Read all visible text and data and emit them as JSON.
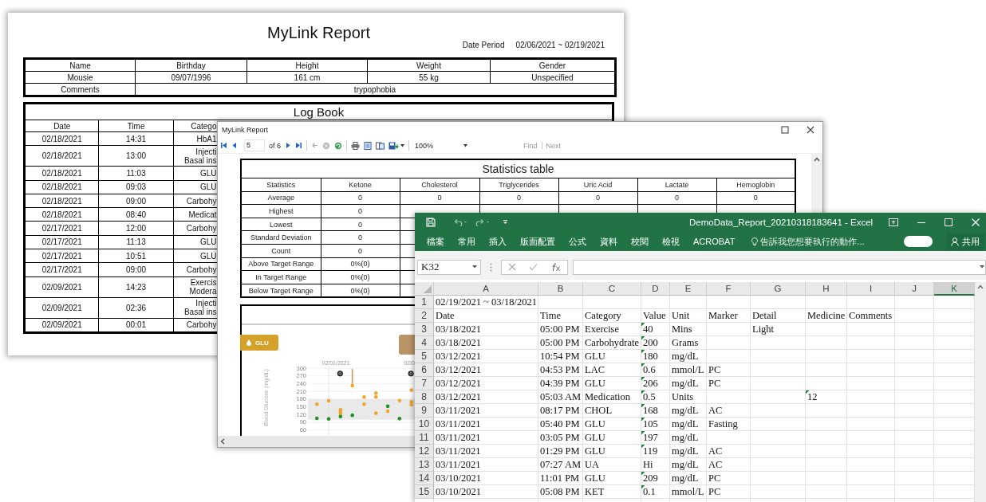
{
  "report_page": {
    "title": "MyLink Report",
    "date_period_label": "Date Period",
    "date_period": "02/06/2021 ~ 02/19/2021",
    "profile": {
      "columns": [
        "Name",
        "Birthday",
        "Height",
        "Weight",
        "Gender"
      ],
      "values": [
        "Mousie",
        "09/07/1996",
        "161 cm",
        "55 kg",
        "Unspecified"
      ],
      "comments_label": "Comments",
      "comments": "trypophobia"
    },
    "log_book": {
      "title": "Log Book",
      "columns": [
        "Date",
        "Time",
        "Catego"
      ],
      "rows": [
        [
          "02/18/2021",
          "14:31",
          "HbA1"
        ],
        [
          "02/18/2021",
          "13:00",
          "Injecti\nBasal ins"
        ],
        [
          "02/18/2021",
          "11:03",
          "GLU"
        ],
        [
          "02/18/2021",
          "09:03",
          "GLU"
        ],
        [
          "02/18/2021",
          "09:00",
          "Carbohy"
        ],
        [
          "02/18/2021",
          "08:40",
          "Medicat"
        ],
        [
          "02/17/2021",
          "12:00",
          "Carbohy"
        ],
        [
          "02/17/2021",
          "11:13",
          "GLU"
        ],
        [
          "02/17/2021",
          "10:51",
          "GLU"
        ],
        [
          "02/17/2021",
          "09:00",
          "Carbohy"
        ],
        [
          "02/09/2021",
          "14:23",
          "Exercis\nModera"
        ],
        [
          "02/09/2021",
          "02:36",
          "Injecti\nBasal ins"
        ],
        [
          "02/09/2021",
          "00:01",
          "Carbohy"
        ]
      ]
    }
  },
  "viewer": {
    "title": "MyLink Report",
    "toolbar": {
      "page": "5",
      "page_count": "of 6",
      "zoom": "100%",
      "find": "Find",
      "next": "Next"
    },
    "statistics": {
      "title": "Statistics table",
      "columns": [
        "Statistics",
        "Ketone",
        "Cholesterol",
        "Triglycerides",
        "Uric Acid",
        "Lactate",
        "Hemoglobin"
      ],
      "rows": [
        {
          "label": "Average",
          "values": [
            "0",
            "0",
            "0",
            "0",
            "0",
            "0"
          ]
        },
        {
          "label": "Highest",
          "values": [
            "0"
          ]
        },
        {
          "label": "Lowest",
          "values": [
            "0"
          ]
        },
        {
          "label": "Standard Deviation",
          "values": [
            "0"
          ]
        },
        {
          "label": "Count",
          "values": [
            "0"
          ]
        },
        {
          "label": "Above Target Range",
          "values": [
            "0%(0)"
          ]
        },
        {
          "label": "In Target Range",
          "values": [
            "0%(0)"
          ]
        },
        {
          "label": "Below Target Range",
          "values": [
            "0%(0)"
          ]
        }
      ]
    },
    "chart_tabs": [
      {
        "label": "GLU",
        "color": "#d4a12a"
      },
      {
        "color": "#b99467"
      }
    ],
    "glucose_plot": {
      "axis_title": "Blood Glucose (mg/dL)",
      "y_labels": [
        "300",
        "270",
        "240",
        "210",
        "180",
        "150",
        "120",
        "90",
        "60"
      ],
      "date_labels": [
        "02/01/2021",
        "02/0"
      ]
    }
  },
  "excel": {
    "title": "DemoData_Report_20210318183641 - Excel",
    "ribbon_tabs": [
      "檔案",
      "常用",
      "插入",
      "版面配置",
      "公式",
      "資料",
      "校閱",
      "檢視",
      "ACROBAT"
    ],
    "tell_me": {
      "placeholder": "告訴我您想要執行的動作..."
    },
    "share": "共用",
    "name_box": "K32",
    "columns": [
      {
        "label": "A",
        "selected": false
      },
      {
        "label": "B",
        "selected": false
      },
      {
        "label": "C",
        "selected": false
      },
      {
        "label": "D",
        "selected": false
      },
      {
        "label": "E",
        "selected": false
      },
      {
        "label": "F",
        "selected": false
      },
      {
        "label": "G",
        "selected": false
      },
      {
        "label": "H",
        "selected": false
      },
      {
        "label": "I",
        "selected": false
      },
      {
        "label": "J",
        "selected": false
      },
      {
        "label": "K",
        "selected": true
      }
    ],
    "rows": [
      {
        "number": "1",
        "cells": [
          "02/19/2021 ~ 03/18/2021"
        ]
      },
      {
        "number": "2",
        "cells": [
          "Date",
          "Time",
          "Category",
          "Value",
          "Unit",
          "Marker",
          "Detail",
          "Medicine",
          "Comments"
        ]
      },
      {
        "number": "3",
        "cells": [
          "03/18/2021",
          "05:00 PM",
          "Exercise",
          {
            "text": "40",
            "flagged": true
          },
          "Mins",
          null,
          "Light"
        ]
      },
      {
        "number": "4",
        "cells": [
          "03/18/2021",
          "05:00 PM",
          "Carbohydrate",
          {
            "text": "200",
            "flagged": true
          },
          "Grams"
        ]
      },
      {
        "number": "5",
        "cells": [
          "03/12/2021",
          "10:54 PM",
          "GLU",
          {
            "text": "180",
            "flagged": true
          },
          "mg/dL"
        ]
      },
      {
        "number": "6",
        "cells": [
          "03/12/2021",
          "04:53 PM",
          "LAC",
          {
            "text": "0.6",
            "flagged": true
          },
          "mmol/L",
          "PC"
        ]
      },
      {
        "number": "7",
        "cells": [
          "03/12/2021",
          "04:39 PM",
          "GLU",
          {
            "text": "206",
            "flagged": true
          },
          "mg/dL",
          "PC"
        ]
      },
      {
        "number": "8",
        "cells": [
          "03/12/2021",
          "05:03 AM",
          "Medication",
          {
            "text": "0.5",
            "flagged": true
          },
          "Units",
          null,
          null,
          {
            "text": "12",
            "flagged": true
          }
        ]
      },
      {
        "number": "9",
        "cells": [
          "03/11/2021",
          "08:17 PM",
          "CHOL",
          {
            "text": "168",
            "flagged": true
          },
          "mg/dL",
          "AC"
        ]
      },
      {
        "number": "10",
        "cells": [
          "03/11/2021",
          "05:40 PM",
          "GLU",
          {
            "text": "105",
            "flagged": true
          },
          "mg/dL",
          "Fasting"
        ]
      },
      {
        "number": "11",
        "cells": [
          "03/11/2021",
          "03:05 PM",
          "GLU",
          {
            "text": "197",
            "flagged": true
          },
          "mg/dL"
        ]
      },
      {
        "number": "12",
        "cells": [
          "03/11/2021",
          "01:29 PM",
          "GLU",
          {
            "text": "119",
            "flagged": true
          },
          "mg/dL",
          "AC"
        ]
      },
      {
        "number": "13",
        "cells": [
          "03/11/2021",
          "07:27 AM",
          "UA",
          {
            "text": "Hi",
            "flagged": false
          },
          "mg/dL",
          "AC"
        ]
      },
      {
        "number": "14",
        "cells": [
          "03/10/2021",
          "11:01 PM",
          "GLU",
          {
            "text": "209",
            "flagged": true
          },
          "mg/dL",
          "PC"
        ]
      },
      {
        "number": "15",
        "cells": [
          "03/10/2021",
          "05:08 PM",
          "KET",
          {
            "text": "0.1",
            "flagged": true
          },
          "mmol/L",
          "PC"
        ]
      }
    ]
  }
}
